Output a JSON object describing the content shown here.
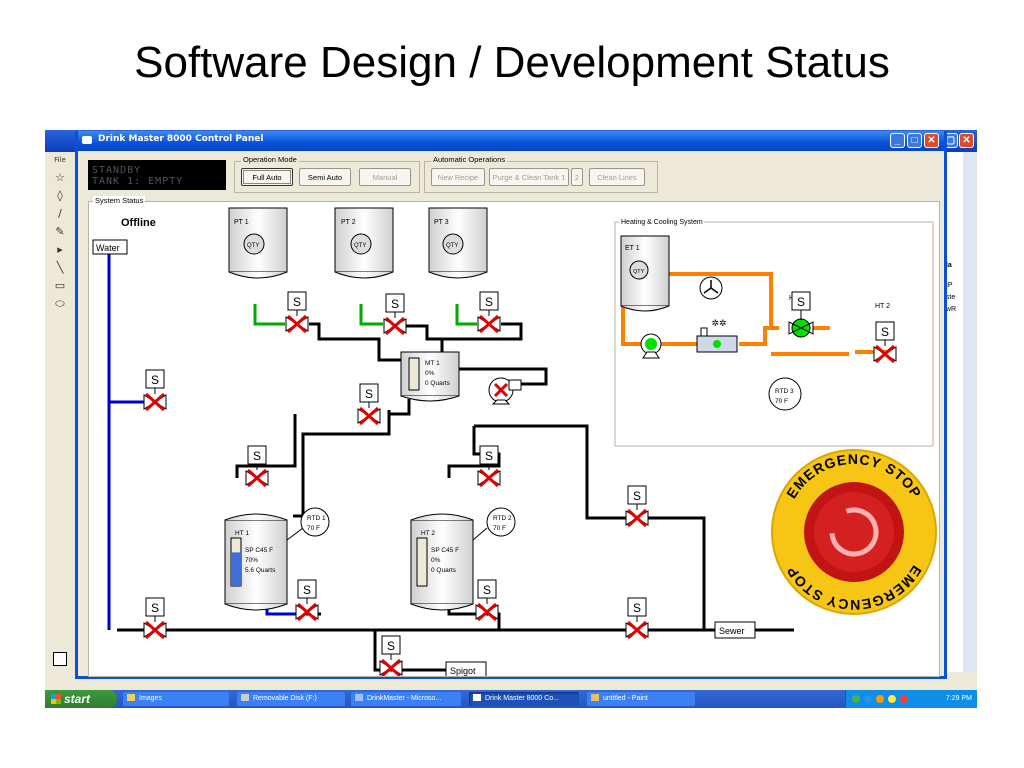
{
  "slide": {
    "title": "Software Design / Development Status"
  },
  "window": {
    "title": "Drink Master 8000 Control Panel"
  },
  "display": {
    "line1": "STANDBY",
    "line2": "TANK 1: EMPTY"
  },
  "operation_mode": {
    "label": "Operation Mode",
    "buttons": [
      "Full Auto",
      "Semi Auto",
      "Manual"
    ],
    "selected": "Full Auto"
  },
  "automatic_operations": {
    "label": "Automatic Operations",
    "buttons": [
      "New Recipe",
      "Purge & Clean Tank 1",
      "2",
      "Clean Lines"
    ]
  },
  "system_status": {
    "label": "System Status",
    "state": "Offline",
    "water": "Water",
    "sewer": "Sewer",
    "spigot": "Spigot",
    "valve_label": "S",
    "qty_label": "QTY",
    "pt1": "PT 1",
    "pt2": "PT 2",
    "pt3": "PT 3",
    "mt1": {
      "name": "MT 1",
      "level": "0%",
      "quarts": "0 Quarts"
    },
    "ht1": {
      "name": "HT 1",
      "sp": "SP C45 F",
      "level": "70%",
      "quarts": "5.6 Quarts",
      "fill": 0.7
    },
    "ht2": {
      "name": "HT 2",
      "sp": "SP C45 F",
      "level": "0%",
      "quarts": "0 Quarts",
      "fill": 0
    },
    "rtd1": {
      "name": "RTD 1",
      "temp": "70 F"
    },
    "rtd2": {
      "name": "RTD 2",
      "temp": "70 F"
    }
  },
  "heating_cooling": {
    "label": "Heating & Cooling System",
    "et1": "ET 1",
    "ht1": "HT 1",
    "ht2": "HT 2",
    "rtd3": {
      "name": "RTD 3",
      "temp": "70 F"
    }
  },
  "emergency": {
    "text": "EMERGENCY STOP"
  },
  "paint": {
    "file_menu": "File",
    "right_text": [
      "Ma",
      "etP",
      "aste",
      "nwR"
    ]
  },
  "taskbar": {
    "start": "start",
    "tasks": [
      "Images",
      "Removable Disk (F:)",
      "DrinkMaster - Microso...",
      "Drink Master 8000 Co...",
      "untitled - Paint"
    ],
    "active": "Drink Master 8000 Co...",
    "clock": "7:29 PM"
  },
  "colors": {
    "water_line": "#0000cc",
    "feed_line": "#00aa00",
    "coolant_line": "#ff8000",
    "valve_x": "#e00000",
    "active_green": "#00e000",
    "ht1_fill": "#3f6fd6",
    "estop_yellow": "#f7c614",
    "estop_red": "#d21a1a"
  }
}
